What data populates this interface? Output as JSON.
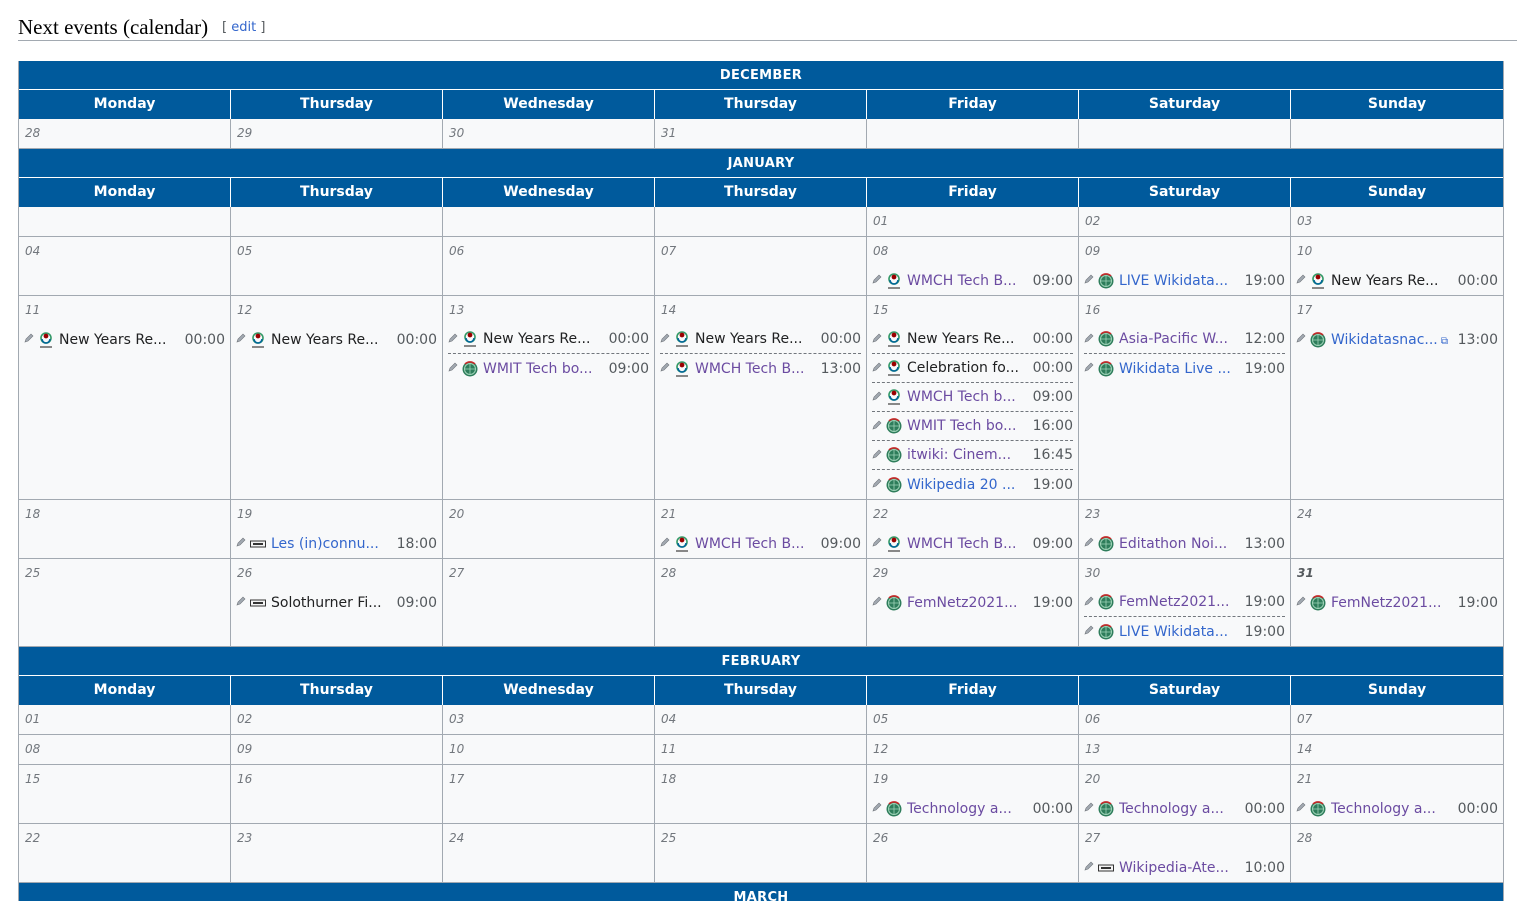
{
  "heading": {
    "title": "Next events (calendar)",
    "edit_open": "[ ",
    "edit_label": "edit",
    "edit_close": " ]"
  },
  "colors": {
    "header_bg": "#005a9c",
    "cell_bg": "#f8f9fa",
    "border": "#a2a9b1",
    "visited": "#6b4ba1",
    "link": "#3366cc"
  },
  "day_names": [
    "Monday",
    "Thursday",
    "Wednesday",
    "Thursday",
    "Friday",
    "Saturday",
    "Sunday"
  ],
  "months": [
    {
      "name": "DECEMBER",
      "weeks": [
        [
          {
            "day": "28"
          },
          {
            "day": "29"
          },
          {
            "day": "30"
          },
          {
            "day": "31"
          },
          {
            "day": ""
          },
          {
            "day": ""
          },
          {
            "day": ""
          }
        ]
      ]
    },
    {
      "name": "JANUARY",
      "weeks": [
        [
          {
            "day": ""
          },
          {
            "day": ""
          },
          {
            "day": ""
          },
          {
            "day": ""
          },
          {
            "day": "01"
          },
          {
            "day": "02"
          },
          {
            "day": "03"
          }
        ],
        [
          {
            "day": "04"
          },
          {
            "day": "05"
          },
          {
            "day": "06"
          },
          {
            "day": "07"
          },
          {
            "day": "08",
            "events": [
              {
                "title": "WMCH Tech B...",
                "time": "09:00",
                "icon": "wmch-icon",
                "style": "visited"
              }
            ]
          },
          {
            "day": "09",
            "events": [
              {
                "title": "LIVE Wikidata...",
                "time": "19:00",
                "icon": "wikimedia-globe-icon",
                "style": "link"
              }
            ]
          },
          {
            "day": "10",
            "events": [
              {
                "title": "New Years Re...",
                "time": "00:00",
                "icon": "wmch-icon",
                "style": "black"
              }
            ]
          }
        ],
        [
          {
            "day": "11",
            "events": [
              {
                "title": "New Years Re...",
                "time": "00:00",
                "icon": "wmch-icon",
                "style": "black"
              }
            ]
          },
          {
            "day": "12",
            "events": [
              {
                "title": "New Years Re...",
                "time": "00:00",
                "icon": "wmch-icon",
                "style": "black"
              }
            ]
          },
          {
            "day": "13",
            "events": [
              {
                "title": "New Years Re...",
                "time": "00:00",
                "icon": "wmch-icon",
                "style": "black"
              },
              {
                "title": "WMIT Tech bo...",
                "time": "09:00",
                "icon": "wikimedia-globe-icon",
                "style": "visited"
              }
            ]
          },
          {
            "day": "14",
            "events": [
              {
                "title": "New Years Re...",
                "time": "00:00",
                "icon": "wmch-icon",
                "style": "black"
              },
              {
                "title": "WMCH Tech B...",
                "time": "13:00",
                "icon": "wmch-icon",
                "style": "visited"
              }
            ]
          },
          {
            "day": "15",
            "events": [
              {
                "title": "New Years Re...",
                "time": "00:00",
                "icon": "wmch-icon",
                "style": "black"
              },
              {
                "title": "Celebration fo...",
                "time": "00:00",
                "icon": "wmch-icon",
                "style": "black"
              },
              {
                "title": "WMCH Tech b...",
                "time": "09:00",
                "icon": "wmch-icon",
                "style": "visited"
              },
              {
                "title": "WMIT Tech bo...",
                "time": "16:00",
                "icon": "wikimedia-globe-icon",
                "style": "visited"
              },
              {
                "title": "itwiki: Cinem...",
                "time": "16:45",
                "icon": "wikimedia-globe-icon",
                "style": "visited"
              },
              {
                "title": "Wikipedia 20 ...",
                "time": "19:00",
                "icon": "wikimedia-globe-icon",
                "style": "link"
              }
            ]
          },
          {
            "day": "16",
            "events": [
              {
                "title": "Asia-Pacific W...",
                "time": "12:00",
                "icon": "wikimedia-globe-icon",
                "style": "visited"
              },
              {
                "title": "Wikidata Live ...",
                "time": "19:00",
                "icon": "wikimedia-globe-icon",
                "style": "link"
              }
            ]
          },
          {
            "day": "17",
            "events": [
              {
                "title": "Wikidatasnac...",
                "time": "13:00",
                "icon": "wikimedia-globe-icon",
                "style": "link",
                "external": true
              }
            ]
          }
        ],
        [
          {
            "day": "18"
          },
          {
            "day": "19",
            "events": [
              {
                "title": "Les (in)connu...",
                "time": "18:00",
                "icon": "ticket-icon",
                "style": "link"
              }
            ]
          },
          {
            "day": "20"
          },
          {
            "day": "21",
            "events": [
              {
                "title": "WMCH Tech B...",
                "time": "09:00",
                "icon": "wmch-icon",
                "style": "visited"
              }
            ]
          },
          {
            "day": "22",
            "events": [
              {
                "title": "WMCH Tech B...",
                "time": "09:00",
                "icon": "wmch-icon",
                "style": "visited"
              }
            ]
          },
          {
            "day": "23",
            "events": [
              {
                "title": "Editathon Noi...",
                "time": "13:00",
                "icon": "wikimedia-globe-icon",
                "style": "visited"
              }
            ]
          },
          {
            "day": "24"
          }
        ],
        [
          {
            "day": "25"
          },
          {
            "day": "26",
            "events": [
              {
                "title": "Solothurner Fi...",
                "time": "09:00",
                "icon": "ticket-icon",
                "style": "black"
              }
            ]
          },
          {
            "day": "27"
          },
          {
            "day": "28"
          },
          {
            "day": "29",
            "events": [
              {
                "title": "FemNetz2021...",
                "time": "19:00",
                "icon": "wikimedia-globe-icon",
                "style": "visited"
              }
            ]
          },
          {
            "day": "30",
            "events": [
              {
                "title": "FemNetz2021...",
                "time": "19:00",
                "icon": "wikimedia-globe-icon",
                "style": "visited"
              },
              {
                "title": "LIVE Wikidata...",
                "time": "19:00",
                "icon": "wikimedia-globe-icon",
                "style": "link"
              }
            ]
          },
          {
            "day": "31",
            "today": true,
            "events": [
              {
                "title": "FemNetz2021...",
                "time": "19:00",
                "icon": "wikimedia-globe-icon",
                "style": "visited"
              }
            ]
          }
        ]
      ]
    },
    {
      "name": "FEBRUARY",
      "weeks": [
        [
          {
            "day": "01"
          },
          {
            "day": "02"
          },
          {
            "day": "03"
          },
          {
            "day": "04"
          },
          {
            "day": "05"
          },
          {
            "day": "06"
          },
          {
            "day": "07"
          }
        ],
        [
          {
            "day": "08"
          },
          {
            "day": "09"
          },
          {
            "day": "10"
          },
          {
            "day": "11"
          },
          {
            "day": "12"
          },
          {
            "day": "13"
          },
          {
            "day": "14"
          }
        ],
        [
          {
            "day": "15"
          },
          {
            "day": "16"
          },
          {
            "day": "17"
          },
          {
            "day": "18"
          },
          {
            "day": "19",
            "events": [
              {
                "title": "Technology a...",
                "time": "00:00",
                "icon": "wikimedia-globe-icon",
                "style": "visited"
              }
            ]
          },
          {
            "day": "20",
            "events": [
              {
                "title": "Technology a...",
                "time": "00:00",
                "icon": "wikimedia-globe-icon",
                "style": "visited"
              }
            ]
          },
          {
            "day": "21",
            "events": [
              {
                "title": "Technology a...",
                "time": "00:00",
                "icon": "wikimedia-globe-icon",
                "style": "visited"
              }
            ]
          }
        ],
        [
          {
            "day": "22"
          },
          {
            "day": "23"
          },
          {
            "day": "24"
          },
          {
            "day": "25"
          },
          {
            "day": "26"
          },
          {
            "day": "27",
            "events": [
              {
                "title": "Wikipedia-Ate...",
                "time": "10:00",
                "icon": "ticket-icon",
                "style": "visited"
              }
            ]
          },
          {
            "day": "28"
          }
        ]
      ]
    },
    {
      "name": "MARCH",
      "weeks": []
    }
  ]
}
